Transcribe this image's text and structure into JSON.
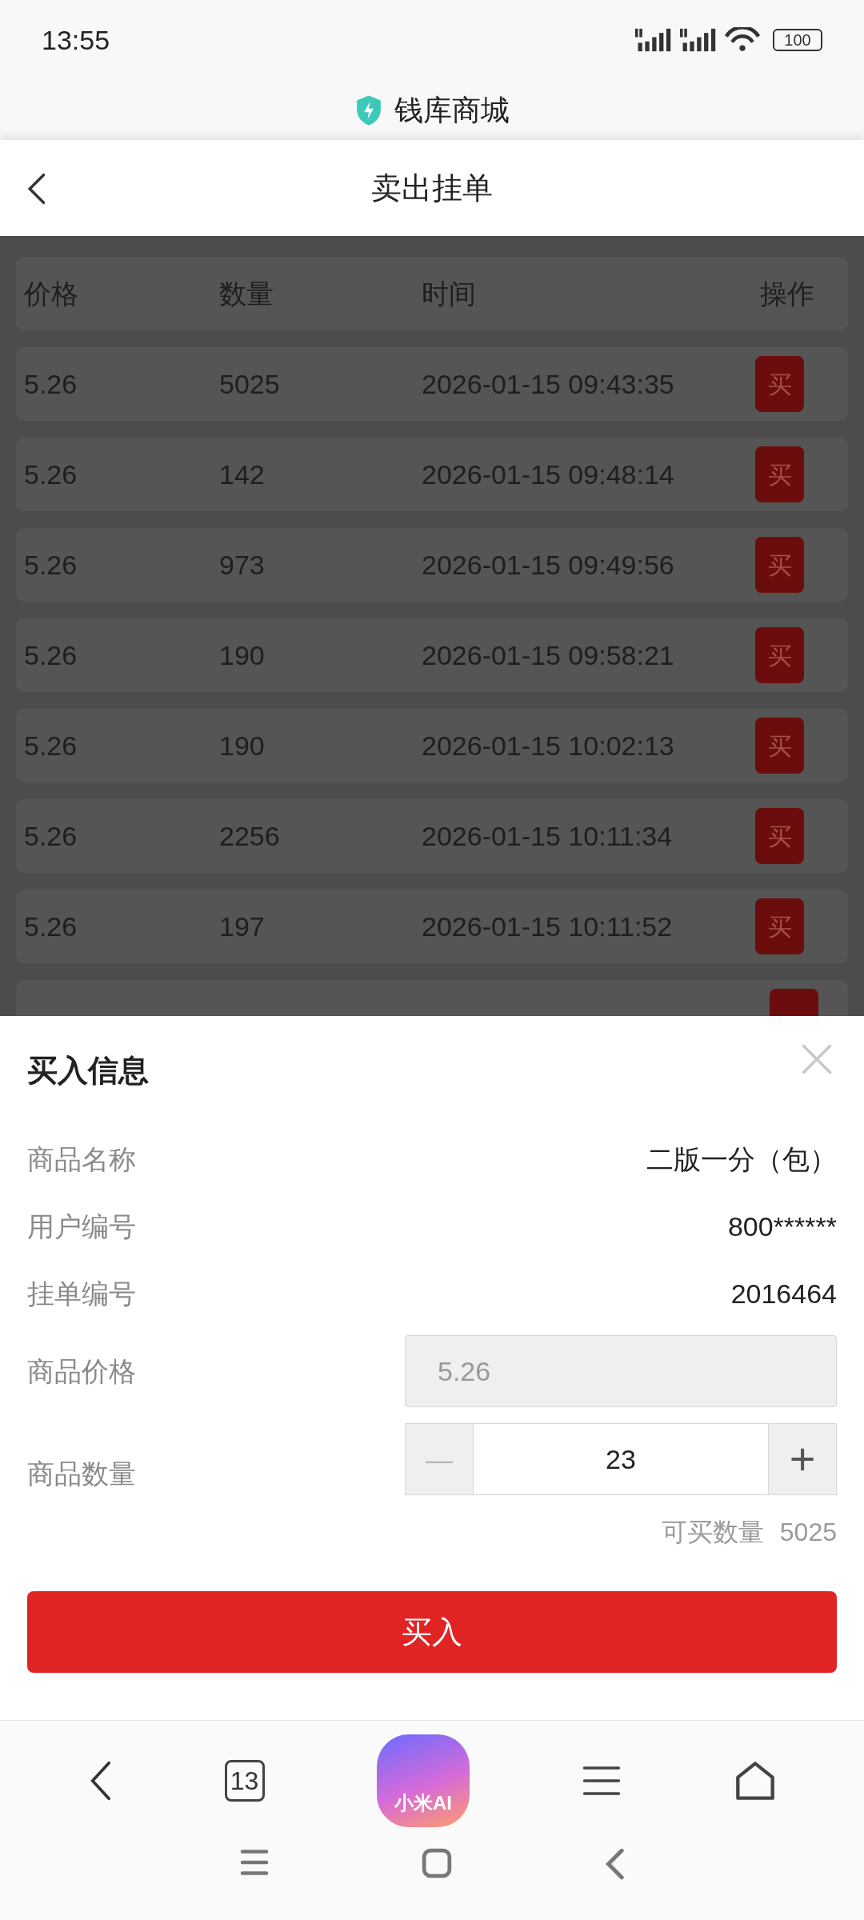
{
  "status_bar": {
    "time": "13:55",
    "battery": "100"
  },
  "browser": {
    "site_title": "钱库商城"
  },
  "header": {
    "title": "卖出挂单"
  },
  "table": {
    "columns": [
      "价格",
      "数量",
      "时间",
      "操作"
    ],
    "rows": [
      {
        "price": "5.26",
        "quantity": "5025",
        "time": "2026-01-15 09:43:35",
        "action": "买"
      },
      {
        "price": "5.26",
        "quantity": "142",
        "time": "2026-01-15 09:48:14",
        "action": "买"
      },
      {
        "price": "5.26",
        "quantity": "973",
        "time": "2026-01-15 09:49:56",
        "action": "买"
      },
      {
        "price": "5.26",
        "quantity": "190",
        "time": "2026-01-15 09:58:21",
        "action": "买"
      },
      {
        "price": "5.26",
        "quantity": "190",
        "time": "2026-01-15 10:02:13",
        "action": "买"
      },
      {
        "price": "5.26",
        "quantity": "2256",
        "time": "2026-01-15 10:11:34",
        "action": "买"
      },
      {
        "price": "5.26",
        "quantity": "197",
        "time": "2026-01-15 10:11:52",
        "action": "买"
      }
    ]
  },
  "sheet": {
    "title": "买入信息",
    "info": [
      {
        "label": "商品名称",
        "value": "二版一分（包）"
      },
      {
        "label": "用户编号",
        "value": "800******"
      },
      {
        "label": "挂单编号",
        "value": "2016464"
      }
    ],
    "price": {
      "label": "商品价格",
      "value": "5.26"
    },
    "quantity": {
      "label": "商品数量",
      "value": "23",
      "minus": "—",
      "plus": "+"
    },
    "available": {
      "label": "可买数量",
      "value": "5025"
    },
    "button": "买入"
  },
  "bottom_bar": {
    "tabs_count": "13",
    "ai_label": "小米AI"
  }
}
